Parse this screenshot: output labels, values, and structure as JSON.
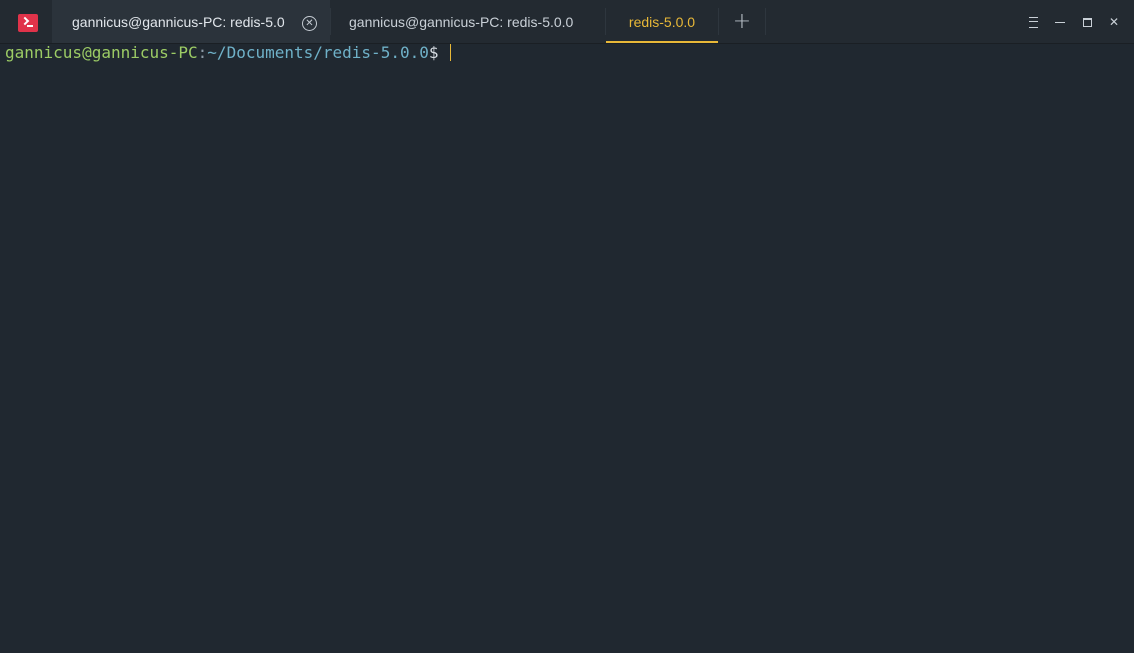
{
  "window": {
    "app_icon": "terminal-icon",
    "tabs": [
      {
        "label": "gannicus@gannicus-PC: redis-5.0",
        "active": false,
        "closable": true
      },
      {
        "label": "gannicus@gannicus-PC: redis-5.0.0",
        "active": false,
        "closable": false
      },
      {
        "label": "redis-5.0.0",
        "active": true,
        "closable": false
      }
    ],
    "new_tab_icon": "plus-icon",
    "controls": [
      "menu-icon",
      "minimize-icon",
      "maximize-icon",
      "close-icon"
    ],
    "accent_color": "#e8b838"
  },
  "terminal": {
    "prompt": {
      "user_host": "gannicus@gannicus-PC",
      "separator": ":",
      "path": "~/Documents/redis-5.0.0",
      "symbol": "$"
    },
    "colors": {
      "background": "#202830",
      "user_host": "#9ccc65",
      "path": "#6fb1c8"
    }
  }
}
